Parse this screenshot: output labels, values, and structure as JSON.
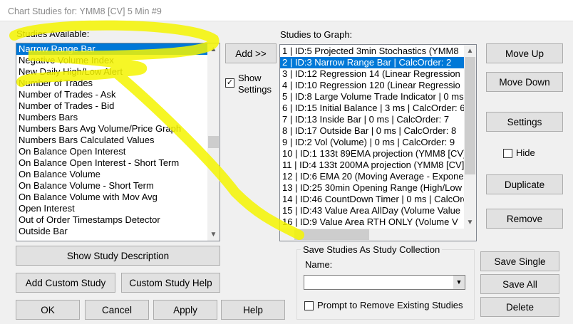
{
  "window": {
    "title": "Chart Studies for: YMM8 [CV]  5 Min   #9"
  },
  "available": {
    "label": "Studies Available:",
    "items": [
      "Narrow Range Bar",
      "Negative Volume Index",
      "New Daily High/Low Alert",
      "Number of Trades",
      "Number of Trades - Ask",
      "Number of Trades - Bid",
      "Numbers Bars",
      "Numbers Bars Avg Volume/Price Graph",
      "Numbers Bars Calculated Values",
      "On Balance Open Interest",
      "On Balance Open Interest - Short Term",
      "On Balance Volume",
      "On Balance Volume - Short Term",
      "On Balance Volume with Mov Avg",
      "Open Interest",
      "Out of Order Timestamps Detector",
      "Outside Bar"
    ],
    "selected_index": 0
  },
  "middle": {
    "add": "Add >>",
    "show_settings": "Show Settings",
    "show_settings_checked": true
  },
  "graph": {
    "label": "Studies to Graph:",
    "items": [
      "1 | ID:5  Projected 3min Stochastics (YMM8",
      "2 | ID:3  Narrow Range Bar | CalcOrder: 2",
      "3 | ID:12  Regression 14 (Linear Regression",
      "4 | ID:10  Regression 120 (Linear Regressio",
      "5 | ID:8  Large Volume Trade Indicator | 0 ms",
      "6 | ID:15  Initial Balance | 3 ms | CalcOrder: 6",
      "7 | ID:13  Inside Bar | 0 ms | CalcOrder: 7",
      "8 | ID:17  Outside Bar | 0 ms | CalcOrder: 8",
      "9 | ID:2  Vol (Volume) | 0 ms | CalcOrder: 9",
      "10 | ID:1  133t 89EMA projection (YMM8 [CV]",
      "11 | ID:4  133t 200MA projection (YMM8 [CV]",
      "12 | ID:6  EMA 20 (Moving Average - Expone",
      "13 | ID:25  30min Opening Range (High/Low",
      "14 | ID:46  CountDown Timer | 0 ms | CalcOrd",
      "15 | ID:43  Value Area AllDay (Volume Value",
      "16 | ID:9  Value Area RTH ONLY (Volume V"
    ],
    "selected_index": 1
  },
  "right_buttons": {
    "move_up": "Move Up",
    "move_down": "Move Down",
    "settings": "Settings",
    "hide": "Hide",
    "hide_checked": false,
    "duplicate": "Duplicate",
    "remove": "Remove"
  },
  "bottom": {
    "show_desc": "Show Study Description",
    "add_custom": "Add Custom Study",
    "custom_help": "Custom Study Help",
    "ok": "OK",
    "cancel": "Cancel",
    "apply": "Apply",
    "help": "Help"
  },
  "collection": {
    "title": "Save Studies As Study Collection",
    "name_label": "Name:",
    "name_value": "",
    "prompt": "Prompt to Remove Existing Studies",
    "prompt_checked": false,
    "save_single": "Save Single",
    "save_all": "Save All",
    "delete": "Delete"
  },
  "colors": {
    "selection": "#0078d7",
    "highlighter": "#f5f500"
  }
}
